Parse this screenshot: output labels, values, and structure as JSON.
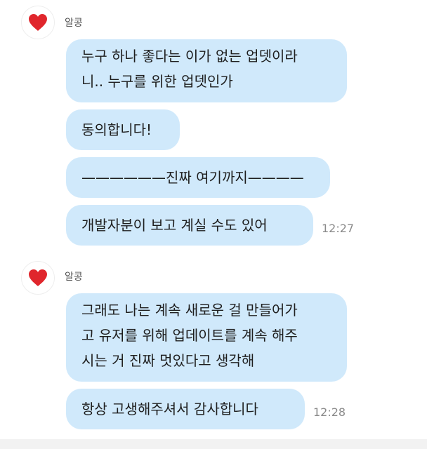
{
  "groups": [
    {
      "sender": "알콩",
      "messages": [
        {
          "lines": [
            "누구 하나 좋다는 이가 없는 업뎃이라",
            "니.. 누구를 위한 업뎃인가"
          ]
        },
        {
          "lines": [
            "동의합니다!"
          ]
        },
        {
          "lines": [
            "——————진짜 여기까지————"
          ]
        },
        {
          "lines": [
            "개발자분이 보고 계실 수도 있어"
          ],
          "time": "12:27"
        }
      ]
    },
    {
      "sender": "알콩",
      "messages": [
        {
          "lines": [
            "그래도 나는 계속 새로운 걸 만들어가",
            "고 유저를 위해 업데이트를 계속 해주",
            "시는 거 진짜 멋있다고 생각해"
          ]
        },
        {
          "lines": [
            "항상 고생해주셔서 감사합니다"
          ],
          "time": "12:28"
        }
      ]
    }
  ],
  "colors": {
    "bubble": "#d0e9fb",
    "heart": "#e0262c"
  },
  "icons": {
    "avatar": "heart-icon"
  }
}
